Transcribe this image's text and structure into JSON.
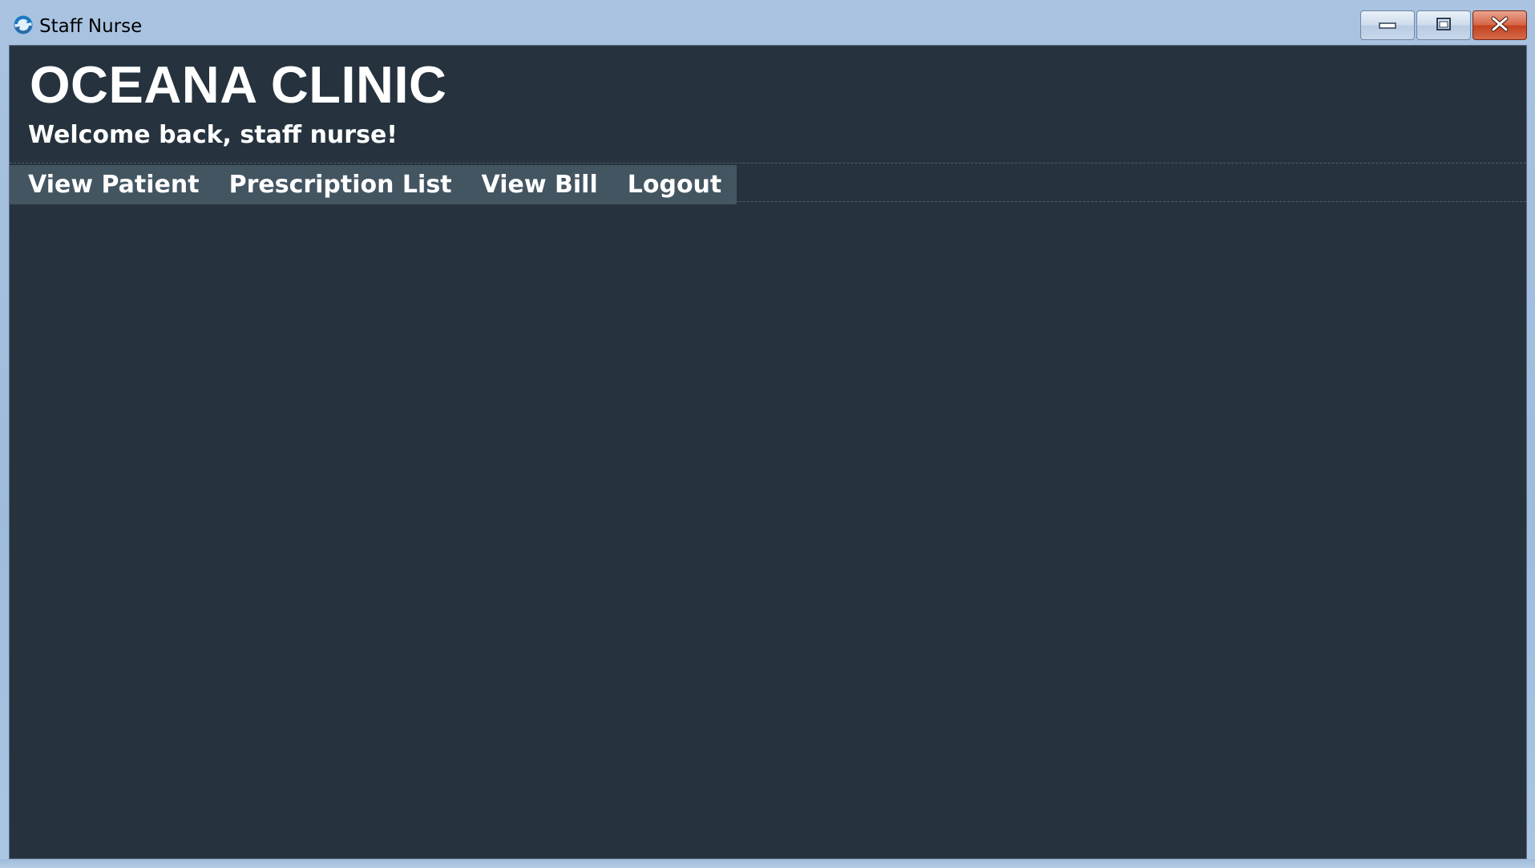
{
  "window": {
    "title": "Staff Nurse",
    "app_icon": "app-refresh-icon",
    "controls": {
      "minimize_icon": "minimize-icon",
      "maximize_icon": "maximize-icon",
      "close_icon": "close-icon"
    }
  },
  "header": {
    "clinic_name": "OCEANA CLINIC",
    "welcome": "Welcome back, staff nurse!"
  },
  "menu": {
    "items": [
      {
        "label": "View Patient"
      },
      {
        "label": "Prescription List"
      },
      {
        "label": "View Bill"
      },
      {
        "label": "Logout"
      }
    ]
  },
  "colors": {
    "background": "#26333e",
    "menu_background": "#435561",
    "text": "#ffffff"
  }
}
